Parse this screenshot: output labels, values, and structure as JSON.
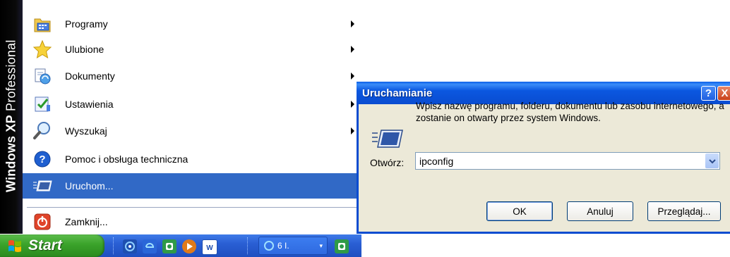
{
  "start_menu": {
    "banner": {
      "windows": "Windows",
      "xp": "XP",
      "edition": "Professional"
    },
    "items": [
      {
        "label": "Programy",
        "icon": "programs-icon",
        "submenu": true
      },
      {
        "label": "Ulubione",
        "icon": "favorites-star-icon",
        "submenu": true
      },
      {
        "label": "Dokumenty",
        "icon": "documents-icon",
        "submenu": true
      },
      {
        "label": "Ustawienia",
        "icon": "settings-icon",
        "submenu": true
      },
      {
        "label": "Wyszukaj",
        "icon": "search-icon",
        "submenu": true
      },
      {
        "label": "Pomoc i obsługa techniczna",
        "icon": "help-icon",
        "submenu": false
      },
      {
        "label": "Uruchom...",
        "icon": "run-icon",
        "submenu": false,
        "selected": true
      },
      {
        "label": "Zamknij...",
        "icon": "shutdown-icon",
        "submenu": false
      }
    ]
  },
  "taskbar": {
    "start_label": "Start",
    "task_button_label": "6 I.",
    "quick_launch": [
      "internet-explorer-icon",
      "browser-icon",
      "app-icon",
      "media-player-icon",
      "word-icon"
    ]
  },
  "run_dialog": {
    "title": "Uruchamianie",
    "help_button": "?",
    "close_button": "X",
    "description": "Wpisz nazwę programu, folderu, dokumentu lub zasobu internetowego, a zostanie on otwarty przez system Windows.",
    "open_label": "Otwórz:",
    "open_value": "ipconfig",
    "ok_label": "OK",
    "cancel_label": "Anuluj",
    "browse_label": "Przeglądaj..."
  },
  "colors": {
    "selection": "#3169c6",
    "titlebar": "#0a4cd0",
    "dialog_bg": "#ece9d8",
    "start_button": "#3aa22a",
    "taskbar": "#2a5fd4"
  }
}
